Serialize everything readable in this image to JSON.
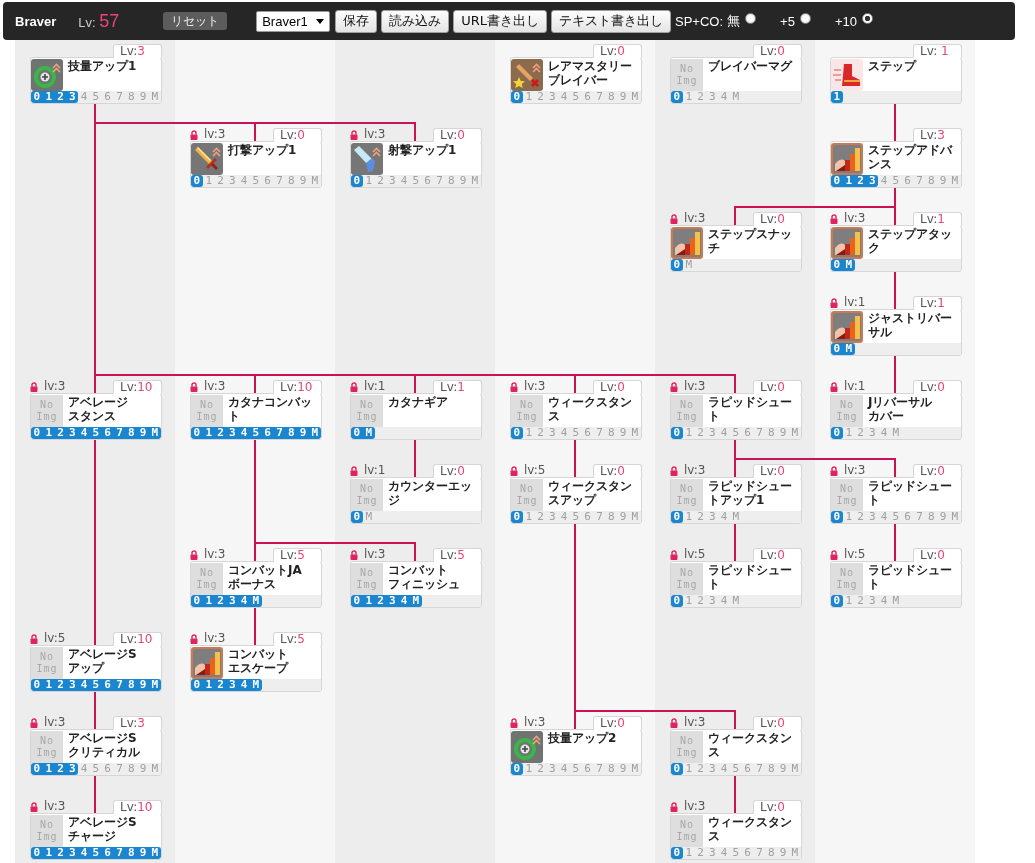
{
  "header": {
    "title": "Braver",
    "lv_label": "Lv:",
    "lv_value": "57",
    "reset_button": "リセット",
    "preset_select": "Braver1",
    "buttons": [
      "保存",
      "読み込み",
      "URL書き出し",
      "テキスト書き出し"
    ],
    "sp_co": {
      "label": "SP+CO:",
      "options": [
        {
          "label": "無",
          "selected": false
        },
        {
          "label": "+5",
          "selected": false
        },
        {
          "label": "+10",
          "selected": true
        }
      ]
    }
  },
  "tree": [
    {
      "name": "技量アップ1",
      "locked": false,
      "lv_label": "Lv:",
      "lv_value": "3",
      "steps": [
        {
          "label": "0",
          "on": true
        },
        {
          "label": "1",
          "on": true
        },
        {
          "label": "2",
          "on": true
        },
        {
          "label": "3",
          "on": true
        },
        {
          "label": "4",
          "on": false
        },
        {
          "label": "5",
          "on": false
        },
        {
          "label": "6",
          "on": false
        },
        {
          "label": "7",
          "on": false
        },
        {
          "label": "8",
          "on": false
        },
        {
          "label": "9",
          "on": false
        },
        {
          "label": "M",
          "on": false
        }
      ],
      "children": [
        {
          "name": "打撃アップ1",
          "locked": true,
          "requirement": "lv:3",
          "lv_label": "Lv:",
          "lv_value": "0",
          "steps": [
            {
              "label": "0",
              "on": true
            },
            {
              "label": "1",
              "on": false
            },
            {
              "label": "2",
              "on": false
            },
            {
              "label": "3",
              "on": false
            },
            {
              "label": "4",
              "on": false
            },
            {
              "label": "5",
              "on": false
            },
            {
              "label": "6",
              "on": false
            },
            {
              "label": "7",
              "on": false
            },
            {
              "label": "8",
              "on": false
            },
            {
              "label": "9",
              "on": false
            },
            {
              "label": "M",
              "on": false
            }
          ]
        },
        {
          "name": "射撃アップ1",
          "locked": true,
          "requirement": "lv:3",
          "lv_label": "Lv:",
          "lv_value": "0",
          "steps": [
            {
              "label": "0",
              "on": true
            },
            {
              "label": "1",
              "on": false
            },
            {
              "label": "2",
              "on": false
            },
            {
              "label": "3",
              "on": false
            },
            {
              "label": "4",
              "on": false
            },
            {
              "label": "5",
              "on": false
            },
            {
              "label": "6",
              "on": false
            },
            {
              "label": "7",
              "on": false
            },
            {
              "label": "8",
              "on": false
            },
            {
              "label": "9",
              "on": false
            },
            {
              "label": "M",
              "on": false
            }
          ]
        },
        {
          "name": "アベレージスタンス",
          "locked": true,
          "requirement": "lv:3",
          "lv_label": "Lv:",
          "lv_value": "10",
          "image_text": "No Img",
          "steps": [
            {
              "label": "0",
              "on": true
            },
            {
              "label": "1",
              "on": true
            },
            {
              "label": "2",
              "on": true
            },
            {
              "label": "3",
              "on": true
            },
            {
              "label": "4",
              "on": true
            },
            {
              "label": "5",
              "on": true
            },
            {
              "label": "6",
              "on": true
            },
            {
              "label": "7",
              "on": true
            },
            {
              "label": "8",
              "on": true
            },
            {
              "label": "9",
              "on": true
            },
            {
              "label": "M",
              "on": true
            }
          ],
          "children": [
            {
              "name": "アベレージSアップ",
              "locked": true,
              "requirement": "lv:5",
              "lv_label": "Lv:",
              "lv_value": "10",
              "image_text": "No Img",
              "steps": [
                {
                  "label": "0",
                  "on": true
                },
                {
                  "label": "1",
                  "on": true
                },
                {
                  "label": "2",
                  "on": true
                },
                {
                  "label": "3",
                  "on": true
                },
                {
                  "label": "4",
                  "on": true
                },
                {
                  "label": "5",
                  "on": true
                },
                {
                  "label": "6",
                  "on": true
                },
                {
                  "label": "7",
                  "on": true
                },
                {
                  "label": "8",
                  "on": true
                },
                {
                  "label": "9",
                  "on": true
                },
                {
                  "label": "M",
                  "on": true
                }
              ],
              "children": [
                {
                  "name": "アベレージSクリティカル",
                  "locked": true,
                  "requirement": "lv:3",
                  "lv_label": "Lv:",
                  "lv_value": "3",
                  "image_text": "No Img",
                  "steps": [
                    {
                      "label": "0",
                      "on": true
                    },
                    {
                      "label": "1",
                      "on": true
                    },
                    {
                      "label": "2",
                      "on": true
                    },
                    {
                      "label": "3",
                      "on": true
                    },
                    {
                      "label": "4",
                      "on": false
                    },
                    {
                      "label": "5",
                      "on": false
                    },
                    {
                      "label": "6",
                      "on": false
                    },
                    {
                      "label": "7",
                      "on": false
                    },
                    {
                      "label": "8",
                      "on": false
                    },
                    {
                      "label": "9",
                      "on": false
                    },
                    {
                      "label": "M",
                      "on": false
                    }
                  ],
                  "children": [
                    {
                      "name": "アベレージSチャージ",
                      "locked": true,
                      "requirement": "lv:3",
                      "lv_label": "Lv:",
                      "lv_value": "10",
                      "image_text": "No Img",
                      "steps": [
                        {
                          "label": "0",
                          "on": true
                        },
                        {
                          "label": "1",
                          "on": true
                        },
                        {
                          "label": "2",
                          "on": true
                        },
                        {
                          "label": "3",
                          "on": true
                        },
                        {
                          "label": "4",
                          "on": true
                        },
                        {
                          "label": "5",
                          "on": true
                        },
                        {
                          "label": "6",
                          "on": true
                        },
                        {
                          "label": "7",
                          "on": true
                        },
                        {
                          "label": "8",
                          "on": true
                        },
                        {
                          "label": "9",
                          "on": true
                        },
                        {
                          "label": "M",
                          "on": true
                        }
                      ]
                    }
                  ]
                }
              ]
            }
          ]
        },
        {
          "name": "カタナコンバット",
          "locked": true,
          "requirement": "lv:3",
          "lv_label": "Lv:",
          "lv_value": "10",
          "image_text": "No Img",
          "steps": [
            {
              "label": "0",
              "on": true
            },
            {
              "label": "1",
              "on": true
            },
            {
              "label": "2",
              "on": true
            },
            {
              "label": "3",
              "on": true
            },
            {
              "label": "4",
              "on": true
            },
            {
              "label": "5",
              "on": true
            },
            {
              "label": "6",
              "on": true
            },
            {
              "label": "7",
              "on": true
            },
            {
              "label": "8",
              "on": true
            },
            {
              "label": "9",
              "on": true
            },
            {
              "label": "M",
              "on": true
            }
          ],
          "children": [
            {
              "name": "コンバットJAボーナス",
              "locked": true,
              "requirement": "lv:3",
              "lv_label": "Lv:",
              "lv_value": "5",
              "image_text": "No Img",
              "steps": [
                {
                  "label": "0",
                  "on": true
                },
                {
                  "label": "1",
                  "on": true
                },
                {
                  "label": "2",
                  "on": true
                },
                {
                  "label": "3",
                  "on": true
                },
                {
                  "label": "4",
                  "on": true
                },
                {
                  "label": "M",
                  "on": true
                }
              ],
              "children": [
                {
                  "name": "コンバットエスケープ",
                  "locked": true,
                  "requirement": "lv:3",
                  "lv_label": "Lv:",
                  "lv_value": "5",
                  "steps": [
                    {
                      "label": "0",
                      "on": true
                    },
                    {
                      "label": "1",
                      "on": true
                    },
                    {
                      "label": "2",
                      "on": true
                    },
                    {
                      "label": "3",
                      "on": true
                    },
                    {
                      "label": "4",
                      "on": true
                    },
                    {
                      "label": "M",
                      "on": true
                    }
                  ]
                }
              ]
            },
            {
              "name": "コンバットフィニッシュ",
              "locked": true,
              "requirement": "lv:3",
              "lv_label": "Lv:",
              "lv_value": "5",
              "image_text": "No Img",
              "steps": [
                {
                  "label": "0",
                  "on": true
                },
                {
                  "label": "1",
                  "on": true
                },
                {
                  "label": "2",
                  "on": true
                },
                {
                  "label": "3",
                  "on": true
                },
                {
                  "label": "4",
                  "on": true
                },
                {
                  "label": "M",
                  "on": true
                }
              ]
            }
          ]
        },
        {
          "name": "カタナギア",
          "locked": true,
          "requirement": "lv:1",
          "lv_label": "Lv:",
          "lv_value": "1",
          "image_text": "No Img",
          "steps": [
            {
              "label": "0",
              "on": true
            },
            {
              "label": "M",
              "on": true
            }
          ],
          "children": [
            {
              "name": "カウンターエッジ",
              "locked": true,
              "requirement": "lv:1",
              "lv_label": "Lv:",
              "lv_value": "0",
              "image_text": "No Img",
              "steps": [
                {
                  "label": "0",
                  "on": true
                },
                {
                  "label": "M",
                  "on": false
                }
              ]
            }
          ]
        },
        {
          "name": "ウィークスタンス",
          "locked": true,
          "requirement": "lv:3",
          "lv_label": "Lv:",
          "lv_value": "0",
          "image_text": "No Img",
          "steps": [
            {
              "label": "0",
              "on": true
            },
            {
              "label": "1",
              "on": false
            },
            {
              "label": "2",
              "on": false
            },
            {
              "label": "3",
              "on": false
            },
            {
              "label": "4",
              "on": false
            },
            {
              "label": "5",
              "on": false
            },
            {
              "label": "6",
              "on": false
            },
            {
              "label": "7",
              "on": false
            },
            {
              "label": "8",
              "on": false
            },
            {
              "label": "9",
              "on": false
            },
            {
              "label": "M",
              "on": false
            }
          ],
          "children": [
            {
              "name": "ウィークスタンスアップ",
              "locked": true,
              "requirement": "lv:5",
              "lv_label": "Lv:",
              "lv_value": "0",
              "image_text": "No Img",
              "steps": [
                {
                  "label": "0",
                  "on": true
                },
                {
                  "label": "1",
                  "on": false
                },
                {
                  "label": "2",
                  "on": false
                },
                {
                  "label": "3",
                  "on": false
                },
                {
                  "label": "4",
                  "on": false
                },
                {
                  "label": "5",
                  "on": false
                },
                {
                  "label": "6",
                  "on": false
                },
                {
                  "label": "7",
                  "on": false
                },
                {
                  "label": "8",
                  "on": false
                },
                {
                  "label": "9",
                  "on": false
                },
                {
                  "label": "M",
                  "on": false
                }
              ],
              "children": [
                {
                  "name": "技量アップ2",
                  "locked": true,
                  "requirement": "lv:3",
                  "lv_label": "Lv:",
                  "lv_value": "0",
                  "steps": [
                    {
                      "label": "0",
                      "on": true
                    },
                    {
                      "label": "1",
                      "on": false
                    },
                    {
                      "label": "2",
                      "on": false
                    },
                    {
                      "label": "3",
                      "on": false
                    },
                    {
                      "label": "4",
                      "on": false
                    },
                    {
                      "label": "5",
                      "on": false
                    },
                    {
                      "label": "6",
                      "on": false
                    },
                    {
                      "label": "7",
                      "on": false
                    },
                    {
                      "label": "8",
                      "on": false
                    },
                    {
                      "label": "9",
                      "on": false
                    },
                    {
                      "label": "M",
                      "on": false
                    }
                  ]
                },
                {
                  "name": "ウィークスタンス",
                  "locked": true,
                  "requirement": "lv:3",
                  "lv_label": "Lv:",
                  "lv_value": "0",
                  "image_text": "No Img",
                  "steps": [
                    {
                      "label": "0",
                      "on": true
                    },
                    {
                      "label": "1",
                      "on": false
                    },
                    {
                      "label": "2",
                      "on": false
                    },
                    {
                      "label": "3",
                      "on": false
                    },
                    {
                      "label": "4",
                      "on": false
                    },
                    {
                      "label": "5",
                      "on": false
                    },
                    {
                      "label": "6",
                      "on": false
                    },
                    {
                      "label": "7",
                      "on": false
                    },
                    {
                      "label": "8",
                      "on": false
                    },
                    {
                      "label": "9",
                      "on": false
                    },
                    {
                      "label": "M",
                      "on": false
                    }
                  ],
                  "children": [
                    {
                      "name": "ウィークスタンス",
                      "locked": true,
                      "requirement": "lv:3",
                      "lv_label": "Lv:",
                      "lv_value": "0",
                      "image_text": "No Img",
                      "steps": [
                        {
                          "label": "0",
                          "on": true
                        },
                        {
                          "label": "1",
                          "on": false
                        },
                        {
                          "label": "2",
                          "on": false
                        },
                        {
                          "label": "3",
                          "on": false
                        },
                        {
                          "label": "4",
                          "on": false
                        },
                        {
                          "label": "5",
                          "on": false
                        },
                        {
                          "label": "6",
                          "on": false
                        },
                        {
                          "label": "7",
                          "on": false
                        },
                        {
                          "label": "8",
                          "on": false
                        },
                        {
                          "label": "9",
                          "on": false
                        },
                        {
                          "label": "M",
                          "on": false
                        }
                      ]
                    }
                  ]
                }
              ]
            }
          ]
        },
        {
          "name": "ラピッドシュート",
          "locked": true,
          "requirement": "lv:3",
          "lv_label": "Lv:",
          "lv_value": "0",
          "image_text": "No Img",
          "steps": [
            {
              "label": "0",
              "on": true
            },
            {
              "label": "1",
              "on": false
            },
            {
              "label": "2",
              "on": false
            },
            {
              "label": "3",
              "on": false
            },
            {
              "label": "4",
              "on": false
            },
            {
              "label": "5",
              "on": false
            },
            {
              "label": "6",
              "on": false
            },
            {
              "label": "7",
              "on": false
            },
            {
              "label": "8",
              "on": false
            },
            {
              "label": "9",
              "on": false
            },
            {
              "label": "M",
              "on": false
            }
          ],
          "children": [
            {
              "name": "ラピッドシュートアップ1",
              "locked": true,
              "requirement": "lv:3",
              "lv_label": "Lv:",
              "lv_value": "0",
              "image_text": "No Img",
              "steps": [
                {
                  "label": "0",
                  "on": true
                },
                {
                  "label": "1",
                  "on": false
                },
                {
                  "label": "2",
                  "on": false
                },
                {
                  "label": "3",
                  "on": false
                },
                {
                  "label": "4",
                  "on": false
                },
                {
                  "label": "M",
                  "on": false
                }
              ],
              "children": [
                {
                  "name": "ラピッドシュート",
                  "locked": true,
                  "requirement": "lv:5",
                  "lv_label": "Lv:",
                  "lv_value": "0",
                  "image_text": "No Img",
                  "steps": [
                    {
                      "label": "0",
                      "on": true
                    },
                    {
                      "label": "1",
                      "on": false
                    },
                    {
                      "label": "2",
                      "on": false
                    },
                    {
                      "label": "3",
                      "on": false
                    },
                    {
                      "label": "4",
                      "on": false
                    },
                    {
                      "label": "M",
                      "on": false
                    }
                  ]
                }
              ]
            },
            {
              "name": "ラピッドシュート",
              "locked": true,
              "requirement": "lv:3",
              "lv_label": "Lv:",
              "lv_value": "0",
              "image_text": "No Img",
              "steps": [
                {
                  "label": "0",
                  "on": true
                },
                {
                  "label": "1",
                  "on": false
                },
                {
                  "label": "2",
                  "on": false
                },
                {
                  "label": "3",
                  "on": false
                },
                {
                  "label": "4",
                  "on": false
                },
                {
                  "label": "5",
                  "on": false
                },
                {
                  "label": "6",
                  "on": false
                },
                {
                  "label": "7",
                  "on": false
                },
                {
                  "label": "8",
                  "on": false
                },
                {
                  "label": "9",
                  "on": false
                },
                {
                  "label": "M",
                  "on": false
                }
              ],
              "children": [
                {
                  "name": "ラピッドシュート",
                  "locked": true,
                  "requirement": "lv:5",
                  "lv_label": "Lv:",
                  "lv_value": "0",
                  "image_text": "No Img",
                  "steps": [
                    {
                      "label": "0",
                      "on": true
                    },
                    {
                      "label": "1",
                      "on": false
                    },
                    {
                      "label": "2",
                      "on": false
                    },
                    {
                      "label": "3",
                      "on": false
                    },
                    {
                      "label": "4",
                      "on": false
                    },
                    {
                      "label": "M",
                      "on": false
                    }
                  ]
                }
              ]
            }
          ]
        }
      ]
    },
    {
      "name": "レアマスタリーブレイバー",
      "locked": false,
      "lv_label": "Lv:",
      "lv_value": "0",
      "steps": [
        {
          "label": "0",
          "on": true
        },
        {
          "label": "1",
          "on": false
        },
        {
          "label": "2",
          "on": false
        },
        {
          "label": "3",
          "on": false
        },
        {
          "label": "4",
          "on": false
        },
        {
          "label": "5",
          "on": false
        },
        {
          "label": "6",
          "on": false
        },
        {
          "label": "7",
          "on": false
        },
        {
          "label": "8",
          "on": false
        },
        {
          "label": "9",
          "on": false
        },
        {
          "label": "M",
          "on": false
        }
      ]
    },
    {
      "name": "ブレイバーマグ",
      "locked": false,
      "lv_label": "Lv:",
      "lv_value": "0",
      "image_text": "No Img",
      "steps": [
        {
          "label": "0",
          "on": true
        },
        {
          "label": "1",
          "on": false
        },
        {
          "label": "2",
          "on": false
        },
        {
          "label": "3",
          "on": false
        },
        {
          "label": "4",
          "on": false
        },
        {
          "label": "M",
          "on": false
        }
      ]
    },
    {
      "name": "ステップ",
      "locked": false,
      "lv_label": "Lv: ",
      "lv_value": "1",
      "steps": [
        {
          "label": "1",
          "on": true
        }
      ],
      "children": [
        {
          "name": "ステップアドバンス",
          "locked": false,
          "lv_label": "Lv:",
          "lv_value": "3",
          "steps": [
            {
              "label": "0",
              "on": true
            },
            {
              "label": "1",
              "on": true
            },
            {
              "label": "2",
              "on": true
            },
            {
              "label": "3",
              "on": true
            },
            {
              "label": "4",
              "on": false
            },
            {
              "label": "5",
              "on": false
            },
            {
              "label": "6",
              "on": false
            },
            {
              "label": "7",
              "on": false
            },
            {
              "label": "8",
              "on": false
            },
            {
              "label": "9",
              "on": false
            },
            {
              "label": "M",
              "on": false
            }
          ],
          "children": [
            {
              "name": "ステップスナッチ",
              "locked": true,
              "requirement": "lv:3",
              "lv_label": "Lv:",
              "lv_value": "0",
              "steps": [
                {
                  "label": "0",
                  "on": true
                },
                {
                  "label": "M",
                  "on": false
                }
              ]
            },
            {
              "name": "ステップアタック",
              "locked": true,
              "requirement": "lv:3",
              "lv_label": "Lv:",
              "lv_value": "1",
              "steps": [
                {
                  "label": "0",
                  "on": true
                },
                {
                  "label": "M",
                  "on": true
                }
              ],
              "children": [
                {
                  "name": "ジャストリバーサル",
                  "locked": true,
                  "requirement": "lv:1",
                  "lv_label": "Lv:",
                  "lv_value": "1",
                  "steps": [
                    {
                      "label": "0",
                      "on": true
                    },
                    {
                      "label": "M",
                      "on": true
                    }
                  ],
                  "children": [
                    {
                      "name": "Jリバーサルカバー",
                      "locked": true,
                      "requirement": "lv:1",
                      "lv_label": "Lv:",
                      "lv_value": "0",
                      "image_text": "No Img",
                      "steps": [
                        {
                          "label": "0",
                          "on": true
                        },
                        {
                          "label": "1",
                          "on": false
                        },
                        {
                          "label": "2",
                          "on": false
                        },
                        {
                          "label": "3",
                          "on": false
                        },
                        {
                          "label": "4",
                          "on": false
                        },
                        {
                          "label": "M",
                          "on": false
                        }
                      ]
                    }
                  ]
                }
              ]
            }
          ]
        }
      ]
    }
  ]
}
